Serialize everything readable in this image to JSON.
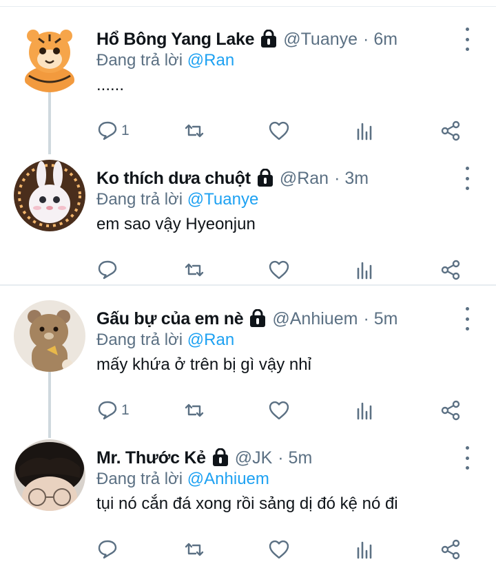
{
  "reply_prefix": "Đang trả lời",
  "tweets": [
    {
      "name": "Hổ Bông Yang Lake",
      "handle": "@Tuanye",
      "time": "· 6m",
      "reply_to": "@Ran",
      "text": "......",
      "reply_count": "1",
      "avatar": "tiger-avatar"
    },
    {
      "name": "Ko thích dưa chuột",
      "handle": "@Ran",
      "time": "· 3m",
      "reply_to": "@Tuanye",
      "text": "em sao vậy Hyeonjun",
      "reply_count": "",
      "avatar": "bunny-avatar"
    },
    {
      "name": "Gấu bự của em nè",
      "handle": "@Anhiuem",
      "time": "· 5m",
      "reply_to": "@Ran",
      "text": "mấy khứa ở trên bị gì vậy nhỉ",
      "reply_count": "1",
      "avatar": "bear-avatar"
    },
    {
      "name": "Mr. Thước Kẻ",
      "handle": "@JK",
      "time": "· 5m",
      "reply_to": "@Anhiuem",
      "text": "tụi nó cắn đá xong rồi sảng dị đó kệ nó đi",
      "reply_count": "",
      "avatar": "person-avatar"
    }
  ],
  "colors": {
    "text": "#0f1419",
    "secondary": "#5b7083",
    "link": "#1da1f2",
    "separator": "#e6ecf0",
    "thread_line": "#cfd9de"
  }
}
